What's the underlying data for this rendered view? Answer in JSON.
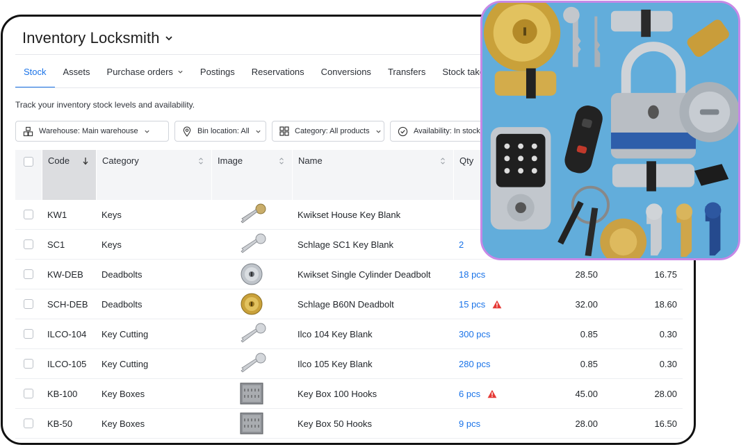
{
  "app": {
    "title": "Inventory Locksmith"
  },
  "tabs": [
    {
      "label": "Stock",
      "active": true
    },
    {
      "label": "Assets"
    },
    {
      "label": "Purchase orders",
      "dropdown": true
    },
    {
      "label": "Postings"
    },
    {
      "label": "Reservations"
    },
    {
      "label": "Conversions"
    },
    {
      "label": "Transfers"
    },
    {
      "label": "Stock takes"
    }
  ],
  "subtitle": "Track your inventory stock levels and availability.",
  "filters": {
    "warehouse": "Warehouse: Main warehouse",
    "bin": "Bin location: All",
    "category": "Category: All products",
    "availability": "Availability: In stock"
  },
  "table": {
    "headers": {
      "code": "Code",
      "category": "Category",
      "image": "Image",
      "name": "Name",
      "qty": "Qty"
    },
    "rows": [
      {
        "code": "KW1",
        "category": "Keys",
        "image": "key-brass",
        "name": "Kwikset House Key Blank",
        "qty": "",
        "price": "",
        "cost": "",
        "warning": false
      },
      {
        "code": "SC1",
        "category": "Keys",
        "image": "key-silver",
        "name": "Schlage SC1 Key Blank",
        "qty": "2",
        "price": "",
        "cost": "",
        "warning": false
      },
      {
        "code": "KW-DEB",
        "category": "Deadbolts",
        "image": "deadbolt-silver",
        "name": "Kwikset Single Cylinder Deadbolt",
        "qty": "18 pcs",
        "price": "28.50",
        "cost": "16.75",
        "warning": false
      },
      {
        "code": "SCH-DEB",
        "category": "Deadbolts",
        "image": "deadbolt-brass",
        "name": "Schlage B60N Deadbolt",
        "qty": "15 pcs",
        "price": "32.00",
        "cost": "18.60",
        "warning": true
      },
      {
        "code": "ILCO-104",
        "category": "Key Cutting",
        "image": "key-silver",
        "name": "Ilco 104 Key Blank",
        "qty": "300 pcs",
        "price": "0.85",
        "cost": "0.30",
        "warning": false
      },
      {
        "code": "ILCO-105",
        "category": "Key Cutting",
        "image": "key-silver",
        "name": "Ilco 105 Key Blank",
        "qty": "280 pcs",
        "price": "0.85",
        "cost": "0.30",
        "warning": false
      },
      {
        "code": "KB-100",
        "category": "Key Boxes",
        "image": "key-box",
        "name": "Key Box 100 Hooks",
        "qty": "6 pcs",
        "price": "45.00",
        "cost": "28.00",
        "warning": true
      },
      {
        "code": "KB-50",
        "category": "Key Boxes",
        "image": "key-box",
        "name": "Key Box 50 Hooks",
        "qty": "9 pcs",
        "price": "28.00",
        "cost": "16.50",
        "warning": false
      }
    ]
  },
  "colors": {
    "accent": "#1a73e8",
    "warning": "#e53935",
    "photo_border": "#c688e6",
    "photo_bg": "#5fa9d8"
  },
  "icons": {
    "warehouse": "warehouse-icon",
    "bin": "location-pin-icon",
    "category": "grid-icon",
    "availability": "check-circle-icon",
    "warning": "warning-triangle-icon"
  }
}
